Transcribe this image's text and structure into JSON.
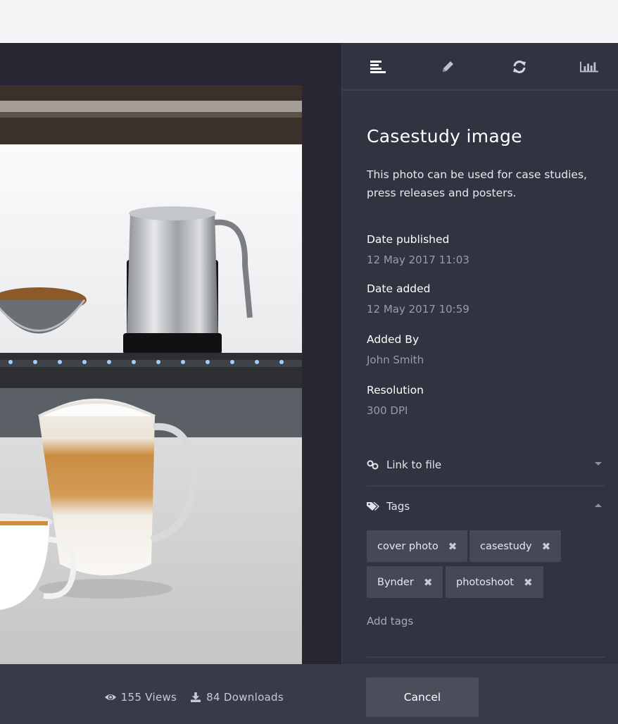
{
  "viewer": {
    "stats": {
      "views": "155 Views",
      "downloads": "84 Downloads"
    }
  },
  "panel": {
    "tabs": [
      {
        "icon": "align-left-icon"
      },
      {
        "icon": "pencil-icon"
      },
      {
        "icon": "refresh-icon"
      },
      {
        "icon": "bar-chart-icon"
      }
    ],
    "title": "Casestudy image",
    "description": "This photo can be used for case studies, press releases and posters.",
    "meta": [
      {
        "label": "Date published",
        "value": "12 May  2017 11:03"
      },
      {
        "label": "Date added",
        "value": "12 May  2017 10:59"
      },
      {
        "label": "Added By",
        "value": "John Smith"
      },
      {
        "label": "Resolution",
        "value": "300 DPI"
      }
    ],
    "link_section": {
      "label": "Link to file",
      "icon": "link-icon"
    },
    "tags_section": {
      "label": "Tags",
      "icon": "tags-icon"
    },
    "tags": [
      "cover photo",
      "casestudy",
      "Bynder",
      "photoshoot"
    ],
    "add_tags": "Add tags",
    "cancel_label": "Cancel"
  },
  "colors": {
    "viewer_bg": "#262732",
    "panel_bg": "#323340",
    "tag_bg": "#474856",
    "footer_bg": "#393a47"
  }
}
